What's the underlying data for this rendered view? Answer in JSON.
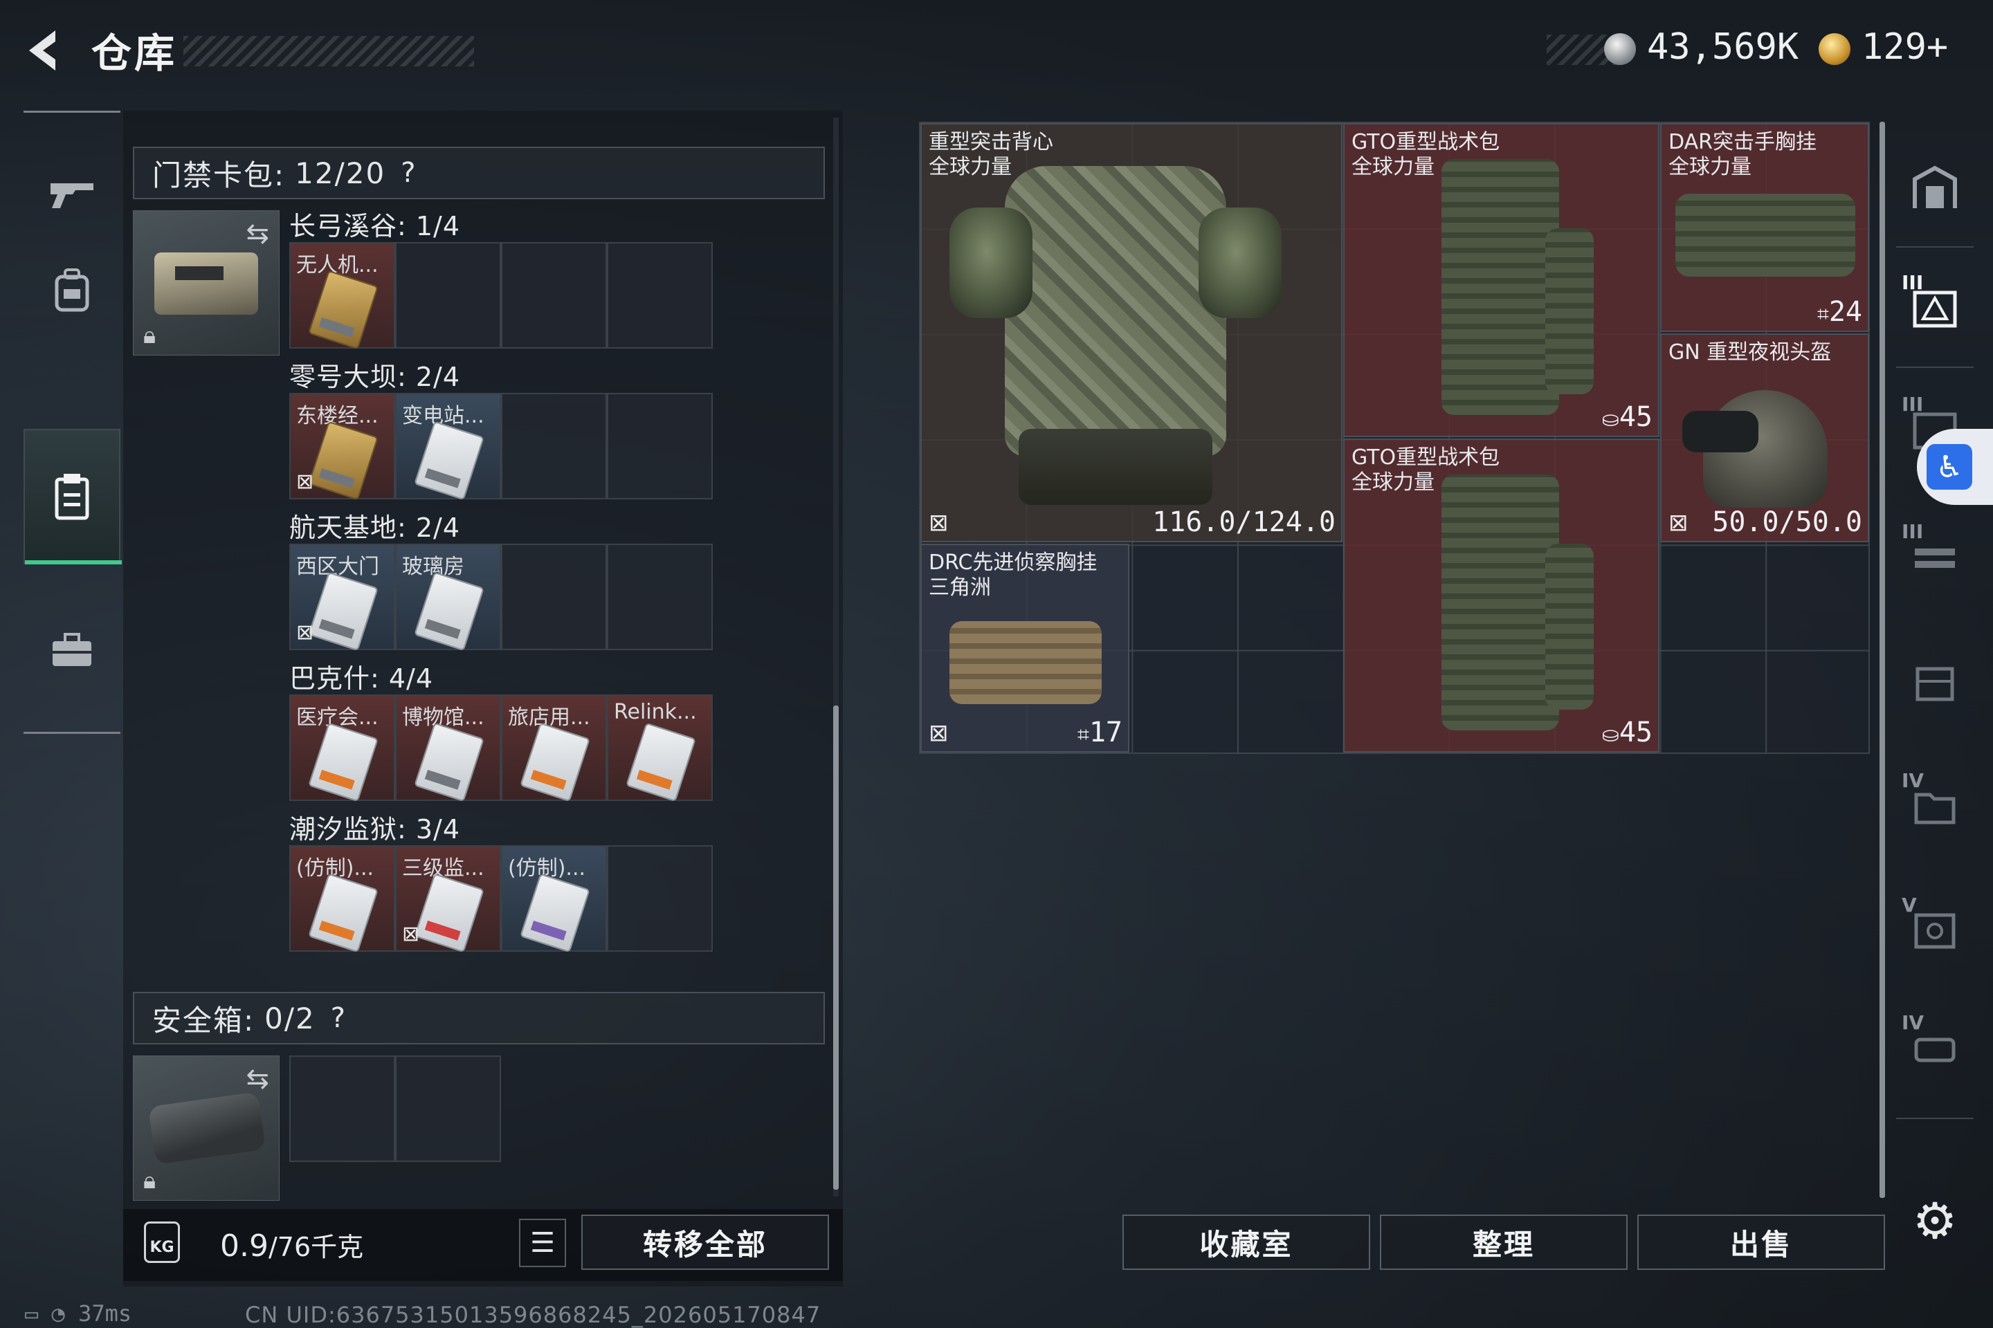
{
  "header": {
    "title": "仓库",
    "silver_amount": "43,569K",
    "gold_amount": "129+"
  },
  "left_nav": {
    "items": [
      "weapons-tab",
      "gear-tab",
      "cards-tab",
      "supplies-tab"
    ],
    "active": "cards-tab"
  },
  "keycard_case": {
    "label": "门禁卡包:",
    "count": "12/20",
    "help": "?",
    "groups": [
      {
        "title": "长弓溪谷: 1/4",
        "items": [
          {
            "name": "无人机...",
            "style": "red",
            "card": "gold",
            "nofx": false
          }
        ]
      },
      {
        "title": "零号大坝: 2/4",
        "items": [
          {
            "name": "东楼经...",
            "style": "red",
            "card": "gold",
            "nofx": true
          },
          {
            "name": "变电站...",
            "style": "blue",
            "card": "white",
            "nofx": false
          }
        ]
      },
      {
        "title": "航天基地: 2/4",
        "items": [
          {
            "name": "西区大门",
            "style": "blue",
            "card": "white",
            "nofx": true
          },
          {
            "name": "玻璃房",
            "style": "blue",
            "card": "white",
            "nofx": false
          }
        ]
      },
      {
        "title": "巴克什: 4/4",
        "items": [
          {
            "name": "医疗会...",
            "style": "red",
            "card": "orange",
            "nofx": false
          },
          {
            "name": "博物馆...",
            "style": "red",
            "card": "white",
            "nofx": false
          },
          {
            "name": "旅店用...",
            "style": "red",
            "card": "orange",
            "nofx": false
          },
          {
            "name": "Relink...",
            "style": "red",
            "card": "orange",
            "nofx": false
          }
        ]
      },
      {
        "title": "潮汐监狱: 3/4",
        "items": [
          {
            "name": "(仿制)...",
            "style": "red",
            "card": "orange",
            "nofx": false
          },
          {
            "name": "三级监...",
            "style": "red",
            "card": "redc",
            "nofx": true
          },
          {
            "name": "(仿制)...",
            "style": "blue",
            "card": "purp",
            "nofx": false
          }
        ]
      }
    ]
  },
  "safe_box": {
    "label": "安全箱:",
    "count": "0/2",
    "help": "?"
  },
  "weight": {
    "value": "0.9",
    "unit": "/76千克",
    "icon_text": "KG"
  },
  "buttons": {
    "transfer_all": "转移全部",
    "collection": "收藏室",
    "organize": "整理",
    "sell": "出售"
  },
  "inventory": [
    {
      "name": "重型突击背心\n全球力量",
      "value": "116.0/124.0"
    },
    {
      "name": "GTO重型战术包\n全球力量",
      "value": "45"
    },
    {
      "name": "DAR突击手胸挂\n全球力量",
      "value": "24"
    },
    {
      "name": "GN 重型夜视头盔",
      "value": "50.0/50.0"
    },
    {
      "name": "GTO重型战术包\n全球力量",
      "value": "45"
    },
    {
      "name": "DRC先进侦察胸挂\n三角洲",
      "value": "17"
    }
  ],
  "right_nav": {
    "labels": [
      "III",
      "III",
      "IV",
      "V",
      "IV"
    ]
  },
  "status": {
    "ping": "37ms",
    "uid": "CN UID:636753150135968682​45_202605170847"
  },
  "colors": {
    "accent_green": "#40c98d",
    "item_red": "#5c2d30",
    "item_blue": "#3a4a5c"
  }
}
